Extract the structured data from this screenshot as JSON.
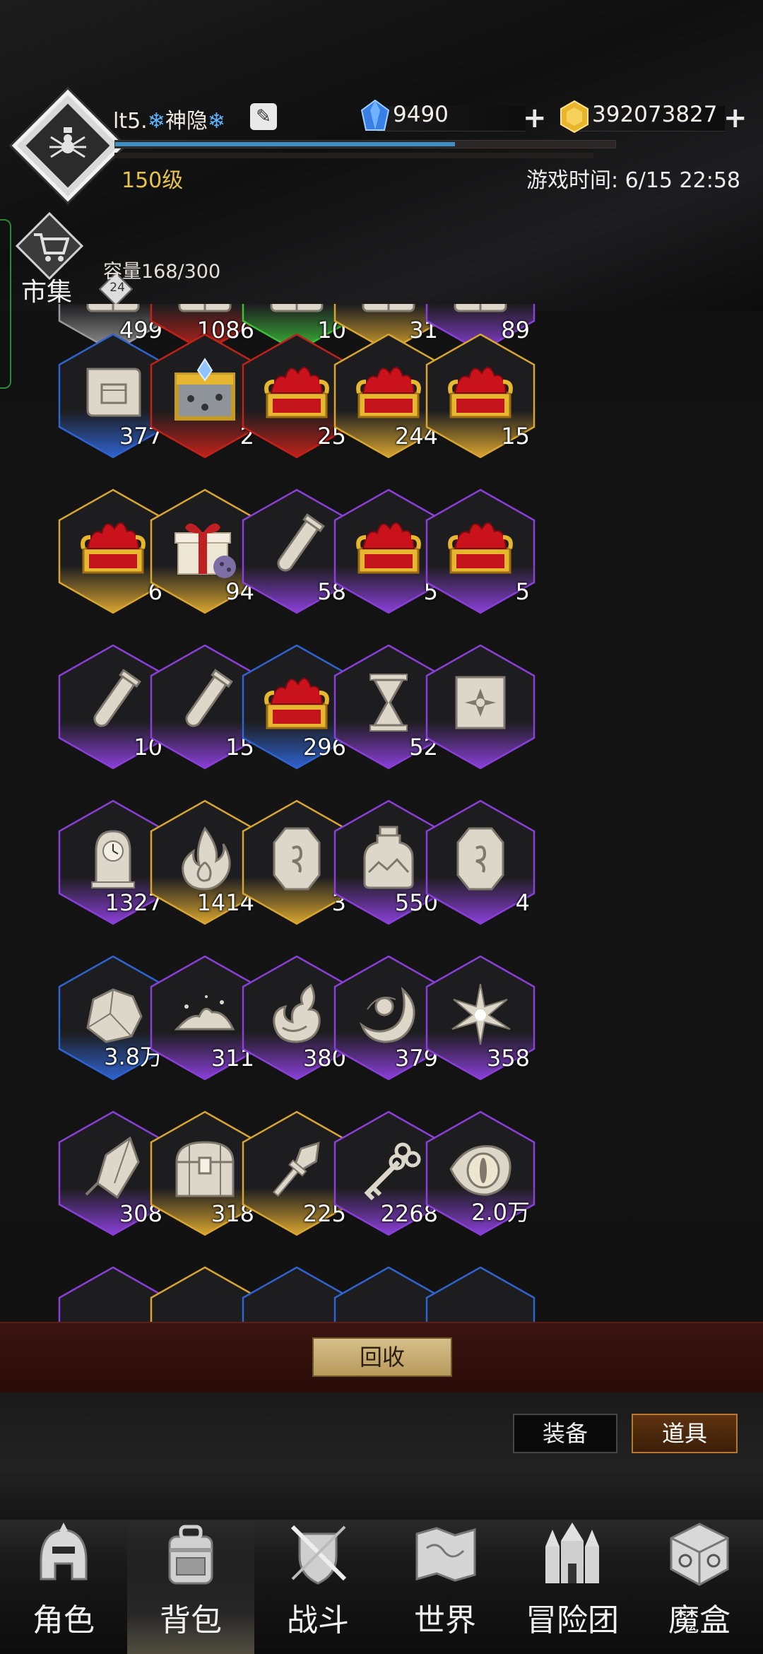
{
  "header": {
    "avatar_level": "24",
    "player": {
      "name_prefix": "lt5.",
      "name": "神隐",
      "level": "150级",
      "xp_fraction": 0.68
    },
    "currency": {
      "gems": {
        "icon": "blue-gem-icon",
        "value": "9490"
      },
      "gold": {
        "icon": "gold-coin-icon",
        "value": "392073827"
      }
    },
    "game_time": "游戏时间: 6/15 22:58"
  },
  "market": {
    "label": "市集"
  },
  "capacity": "容量168/300",
  "grid": {
    "items": [
      {
        "count": "499",
        "rarity": "white",
        "icon": "book-icon"
      },
      {
        "count": "1086",
        "rarity": "red",
        "icon": "book-icon"
      },
      {
        "count": "10",
        "rarity": "green",
        "icon": "book-icon"
      },
      {
        "count": "31",
        "rarity": "gold",
        "icon": "book-icon"
      },
      {
        "count": "89",
        "rarity": "purple",
        "icon": "book-icon"
      },
      {
        "count": "377",
        "rarity": "blue",
        "icon": "blueprint-scroll-icon"
      },
      {
        "count": "2",
        "rarity": "red",
        "icon": "gold-crate-icon"
      },
      {
        "count": "25",
        "rarity": "red",
        "icon": "ruby-chest-icon"
      },
      {
        "count": "244",
        "rarity": "gold",
        "icon": "ruby-chest-icon"
      },
      {
        "count": "15",
        "rarity": "gold",
        "icon": "ruby-chest-icon"
      },
      {
        "count": "6",
        "rarity": "gold",
        "icon": "ruby-chest-icon"
      },
      {
        "count": "94",
        "rarity": "gold",
        "icon": "gift-box-icon"
      },
      {
        "count": "58",
        "rarity": "purple",
        "icon": "test-tube-icon"
      },
      {
        "count": "5",
        "rarity": "purple",
        "icon": "ruby-chest-icon"
      },
      {
        "count": "5",
        "rarity": "purple",
        "icon": "ruby-chest-icon"
      },
      {
        "count": "10",
        "rarity": "purple",
        "icon": "test-tube-icon"
      },
      {
        "count": "15",
        "rarity": "purple",
        "icon": "test-tube-icon"
      },
      {
        "count": "296",
        "rarity": "blue",
        "icon": "ruby-chest-icon"
      },
      {
        "count": "52",
        "rarity": "purple",
        "icon": "hourglass-icon"
      },
      {
        "count": "",
        "rarity": "purple",
        "icon": "shuriken-scroll-icon"
      },
      {
        "count": "1327",
        "rarity": "purple",
        "icon": "clock-icon"
      },
      {
        "count": "1414",
        "rarity": "gold",
        "icon": "flame-icon"
      },
      {
        "count": "3",
        "rarity": "gold",
        "icon": "rune-stone-icon"
      },
      {
        "count": "550",
        "rarity": "purple",
        "icon": "jar-icon"
      },
      {
        "count": "4",
        "rarity": "purple",
        "icon": "rune-stone-icon"
      },
      {
        "count": "3.8万",
        "rarity": "blue",
        "icon": "rock-icon"
      },
      {
        "count": "311",
        "rarity": "purple",
        "icon": "dust-icon"
      },
      {
        "count": "380",
        "rarity": "purple",
        "icon": "fire-wisp-icon"
      },
      {
        "count": "379",
        "rarity": "purple",
        "icon": "crescent-orb-icon"
      },
      {
        "count": "358",
        "rarity": "purple",
        "icon": "spark-icon"
      },
      {
        "count": "308",
        "rarity": "purple",
        "icon": "crystal-shard-icon"
      },
      {
        "count": "318",
        "rarity": "gold",
        "icon": "treasure-chest-icon"
      },
      {
        "count": "225",
        "rarity": "gold",
        "icon": "crystal-staff-icon"
      },
      {
        "count": "2268",
        "rarity": "purple",
        "icon": "key-icon"
      },
      {
        "count": "2.0万",
        "rarity": "purple",
        "icon": "dragon-eye-icon"
      }
    ]
  },
  "actions": {
    "recycle": "回收"
  },
  "filters": {
    "equip": "装备",
    "items": "道具",
    "active": "items"
  },
  "nav": [
    {
      "label": "角色",
      "icon": "helmet-icon",
      "active": false
    },
    {
      "label": "背包",
      "icon": "backpack-icon",
      "active": true
    },
    {
      "label": "战斗",
      "icon": "swords-shield-icon",
      "active": false
    },
    {
      "label": "世界",
      "icon": "map-scroll-icon",
      "active": false
    },
    {
      "label": "冒险团",
      "icon": "castle-icon",
      "active": false
    },
    {
      "label": "魔盒",
      "icon": "magic-cube-icon",
      "active": false
    }
  ],
  "colors": {
    "white": "#9a9a9a",
    "red": "#c0221a",
    "green": "#3cbf3a",
    "gold": "#d8a530",
    "purple": "#8a3fd8",
    "blue": "#2f63d0",
    "accent_gold": "#e6c44c",
    "xp_blue": "#3b8fc5"
  }
}
